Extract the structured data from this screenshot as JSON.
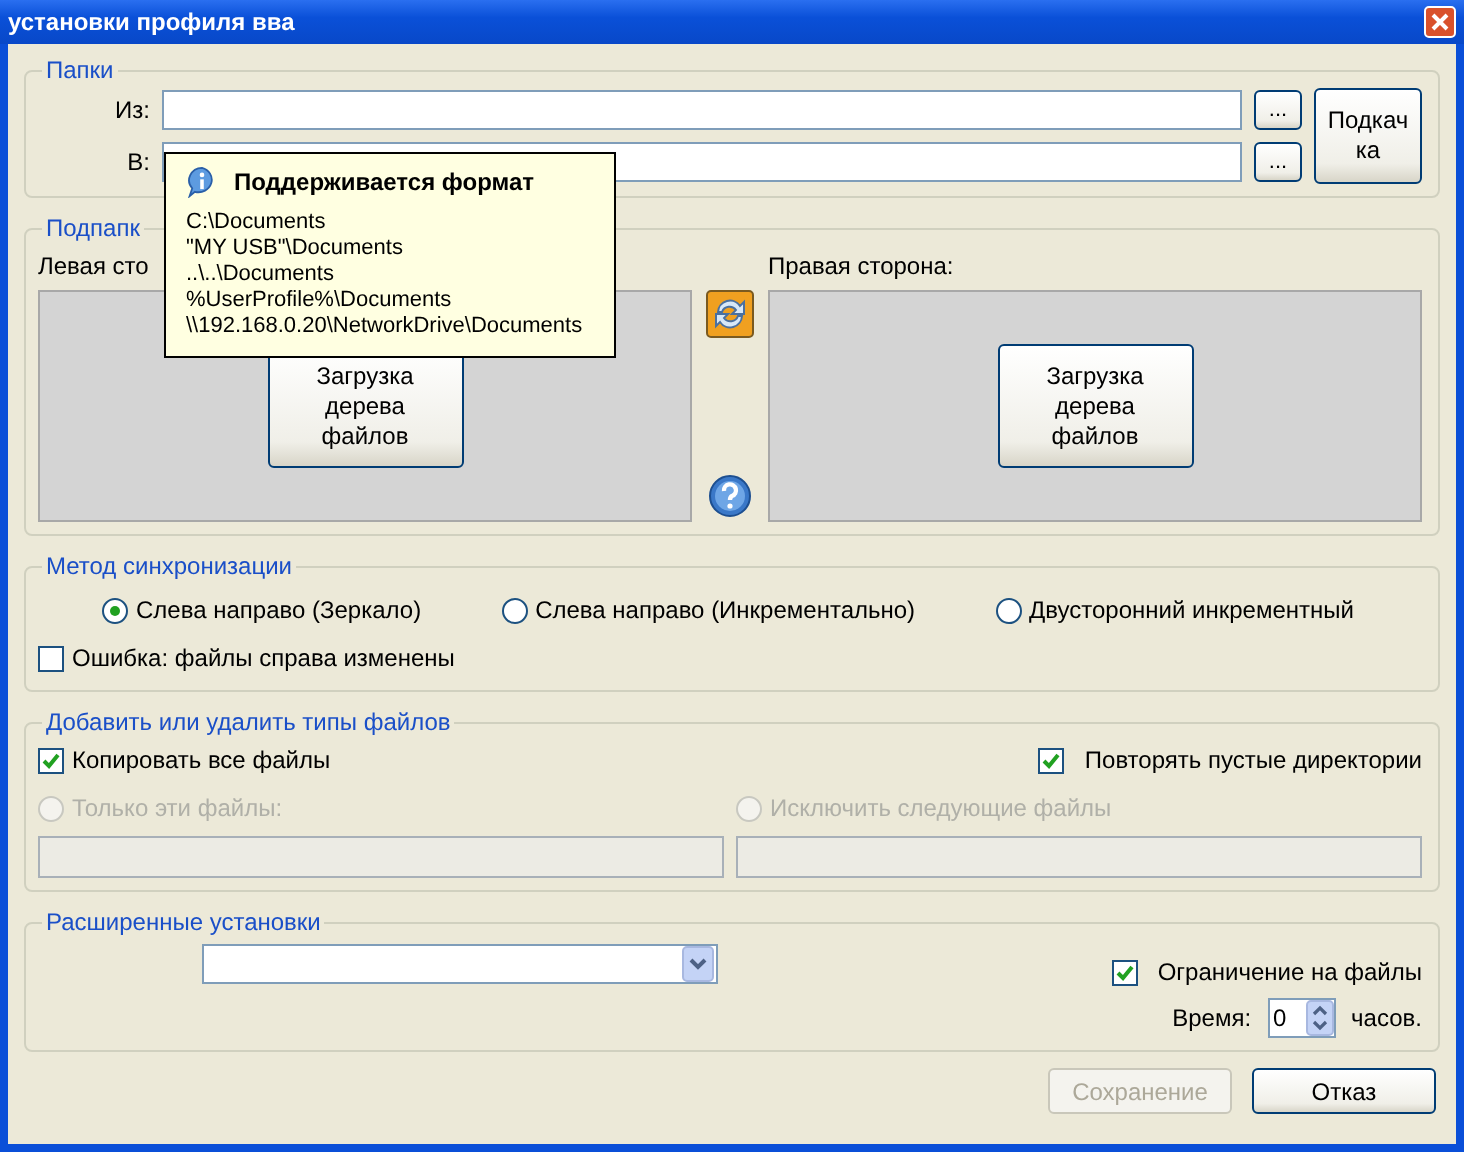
{
  "window": {
    "title": "установки профиля вва"
  },
  "folders": {
    "title": "Папки",
    "from_label": "Из:",
    "to_label": "В:",
    "browse_buttons": [
      "...",
      "..."
    ],
    "swap_button": "Подкачка"
  },
  "tooltip": {
    "title": "Поддерживается формат",
    "lines": [
      "C:\\Documents",
      "\"MY USB\"\\Documents",
      "..\\..\\Documents",
      "%UserProfile%\\Documents",
      "\\\\192.168.0.20\\NetworkDrive\\Documents"
    ]
  },
  "subfolders": {
    "title": "Подпапк",
    "left_label": "Левая сто",
    "right_label": "Правая сторона:",
    "load_buttons": [
      "Загрузка дерева файлов",
      "Загрузка дерева файлов"
    ]
  },
  "sync": {
    "title": "Метод синхронизации",
    "options": [
      {
        "label": "Слева направо (Зеркало)",
        "selected": true
      },
      {
        "label": "Слева направо (Инкрементально)",
        "selected": false
      },
      {
        "label": "Двусторонний инкрементный",
        "selected": false
      }
    ],
    "error_check": {
      "label": "Ошибка: файлы справа изменены",
      "checked": false
    }
  },
  "filetypes": {
    "title": "Добавить или удалить типы файлов",
    "copy_all": {
      "label": "Копировать все файлы",
      "checked": true
    },
    "repeat_empty": {
      "label": "Повторять пустые директории",
      "checked": true
    },
    "filters": [
      {
        "label": "Только эти файлы:",
        "selected": false,
        "disabled": true
      },
      {
        "label": "Исключить следующие файлы",
        "selected": false,
        "disabled": true
      }
    ]
  },
  "advanced": {
    "title": "Расширенные установки",
    "limit": {
      "label": "Ограничение на файлы",
      "checked": true
    },
    "time_label": "Время:",
    "time_value": "0",
    "time_unit": "часов."
  },
  "buttons": [
    {
      "label": "Сохранение",
      "disabled": true
    },
    {
      "label": "Отказ",
      "disabled": false
    }
  ]
}
